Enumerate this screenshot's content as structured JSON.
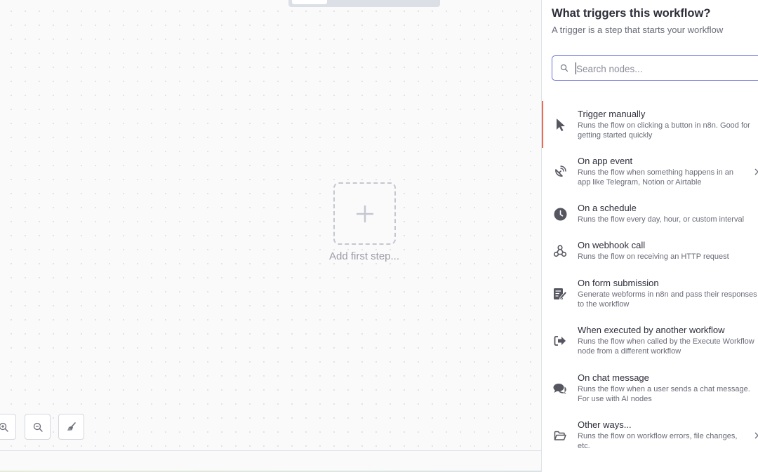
{
  "canvas": {
    "add_first_step_label": "Add first step..."
  },
  "controls": {
    "zoom_in_icon": "zoom-in-icon",
    "zoom_out_icon": "zoom-out-icon",
    "tidy_up_icon": "broom-icon"
  },
  "panel": {
    "title": "What triggers this workflow?",
    "subtitle": "A trigger is a step that starts your workflow",
    "search_placeholder": "Search nodes...",
    "search_value": "",
    "items": [
      {
        "name": "Trigger manually",
        "desc": "Runs the flow on clicking a button in n8n. Good for getting started quickly",
        "icon": "cursor-icon",
        "selected": true
      },
      {
        "name": "On app event",
        "desc": "Runs the flow when something happens in an app like Telegram, Notion or Airtable",
        "icon": "satellite-dish-icon"
      },
      {
        "name": "On a schedule",
        "desc": "Runs the flow every day, hour, or custom interval",
        "icon": "clock-icon"
      },
      {
        "name": "On webhook call",
        "desc": "Runs the flow on receiving an HTTP request",
        "icon": "webhook-icon"
      },
      {
        "name": "On form submission",
        "desc": "Generate webforms in n8n and pass their responses to the workflow",
        "icon": "form-icon"
      },
      {
        "name": "When executed by another workflow",
        "desc": "Runs the flow when called by the Execute Workflow node from a different workflow",
        "icon": "sign-in-icon"
      },
      {
        "name": "On chat message",
        "desc": "Runs the flow when a user sends a chat message. For use with AI nodes",
        "icon": "chat-icon"
      },
      {
        "name": "Other ways...",
        "desc": "Runs the flow on workflow errors, file changes, etc.",
        "icon": "folder-open-icon"
      }
    ]
  },
  "colors": {
    "accent": "#6b6fd6",
    "selected_marker": "#ee6b53",
    "icon": "#55565f"
  }
}
